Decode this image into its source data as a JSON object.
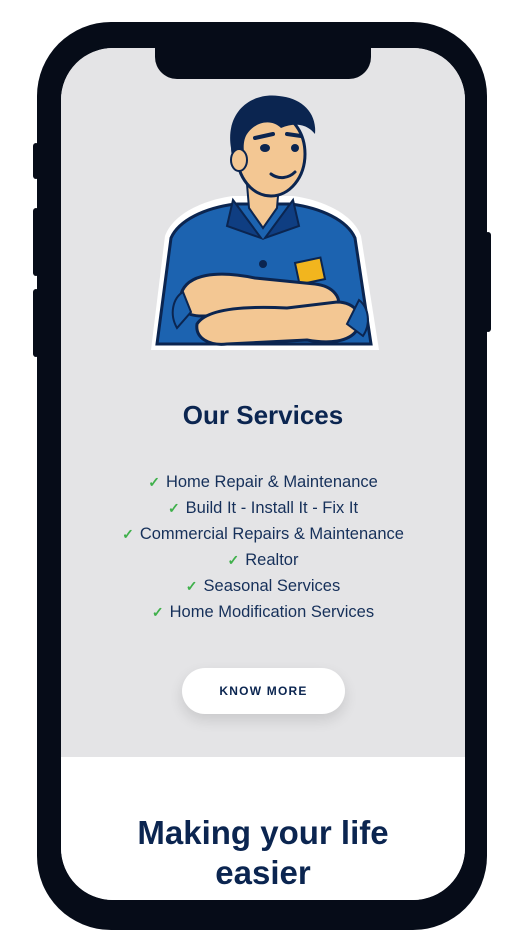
{
  "services": {
    "title": "Our Services",
    "items": [
      "Home Repair & Maintenance",
      "Build It - Install It - Fix It",
      "Commercial Repairs & Maintenance",
      "Realtor",
      "Seasonal Services",
      "Home Modification Services"
    ],
    "button_label": "KNOW MORE"
  },
  "life": {
    "title_line1": "Making your life",
    "title_line2": "easier"
  },
  "colors": {
    "navy": "#0b2550",
    "check_green": "#3fb04b",
    "section_bg": "#e4e4e6",
    "phone_frame": "#060c18"
  },
  "icons": [
    "handyman-mascot-icon",
    "check-icon"
  ]
}
